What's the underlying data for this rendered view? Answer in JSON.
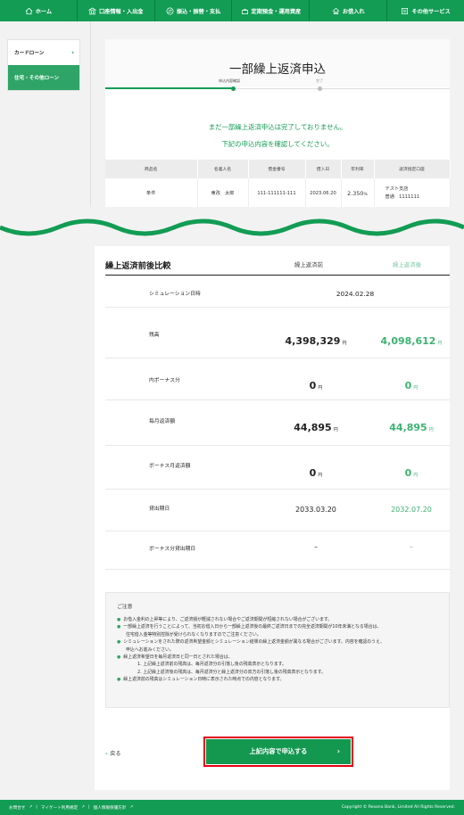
{
  "nav": {
    "items": [
      {
        "label": "ホーム",
        "icon": "home-icon"
      },
      {
        "label": "口座情報・入出金",
        "icon": "bank-icon"
      },
      {
        "label": "振込・振替・支払",
        "icon": "transfer-icon"
      },
      {
        "label": "定期預金・運用資産",
        "icon": "savings-icon"
      },
      {
        "label": "お借入れ",
        "icon": "loan-icon"
      },
      {
        "label": "その他サービス",
        "icon": "services-icon"
      }
    ]
  },
  "sidebar": {
    "items": [
      {
        "label": "カードローン",
        "chevron": "›"
      },
      {
        "label": "住宅・その他ローン"
      }
    ]
  },
  "header": {
    "title": "一部繰上返済申込",
    "steps": [
      {
        "label": "申込内容確認"
      },
      {
        "label": "完了"
      }
    ]
  },
  "notice": {
    "line1": "まだ一部繰上返済申込は完了しておりません。",
    "line2": "下記の申込内容を確認してください。"
  },
  "loan_table": {
    "headers": [
      "商品名",
      "名義人名",
      "借金番号",
      "借入日",
      "年利率",
      "返済指定口座"
    ],
    "row": {
      "product": "条件",
      "name": "東改　太郎",
      "number": "111-111111-111",
      "date": "2023.06.20",
      "rate": "2.350",
      "rate_unit": "%",
      "account_branch": "テスト支店",
      "account_number": "普通　1111111"
    }
  },
  "comparison": {
    "title": "繰上返済前後比較",
    "before_label": "繰上返済前",
    "after_label": "繰上返済後",
    "rows": [
      {
        "label": "シミュレーション日時",
        "value": "2024.02.28"
      },
      {
        "label": "残高",
        "before": "4,398,329",
        "after": "4,098,612",
        "unit": "円"
      },
      {
        "label": "内ボーナス分",
        "before": "0",
        "after": "0",
        "unit": "円"
      },
      {
        "label": "毎月返済額",
        "before": "44,895",
        "after": "44,895",
        "unit": "円"
      },
      {
        "label": "ボーナス月返済額",
        "before": "0",
        "after": "0",
        "unit": "円"
      },
      {
        "label": "貸出期日",
        "before": "2033.03.20",
        "after": "2032.07.20"
      },
      {
        "label": "ボーナス分貸出期日",
        "before": "–",
        "after": "–"
      }
    ]
  },
  "caution": {
    "title": "ご注意",
    "lines": [
      "お借入金利の上昇等により、ご返済額が軽減されない場合やご返済期間が短縮されない場合がございます。",
      "一部繰上返済を行うことによって、当初お借入日から一部繰上返済後の最終ご返済日までの完全返済期間が10年未満となる場合は、",
      "住宅借入金等特別控除が受けられなくなりますのでご注意ください。",
      "シミュレーションをされた際の返済希望金額とシミュレーション結果の繰上返済金額が異なる場合がございます。内容を確認のうえ、",
      "申込へお進みください。",
      "繰上返済希望日を毎月返済日と同一日とされた場合は、",
      "1. 上記繰上返済前の残高は、毎月返済分の引落し後の残高表示となります。",
      "2. 上記繰上返済後の残高は、毎月返済分と繰上返済分の双方の引落し後の残高表示となります。",
      "繰上返済前の残高はシミュレーション日時に表示された時点での内容となります。"
    ]
  },
  "actions": {
    "back_label": "戻る",
    "back_icon": "‹",
    "submit_label": "上記内容で申込する",
    "submit_icon": "›"
  },
  "footer": {
    "links": [
      "お問合せ",
      "マイゲート利用規定",
      "個人情報保護方針"
    ],
    "copyright": "Copyright © Resona Bank, Limited All Rights Reserved."
  },
  "colors": {
    "brand_green": "#129c54",
    "after_green": "#3cb371",
    "highlight_red": "#e60012"
  }
}
